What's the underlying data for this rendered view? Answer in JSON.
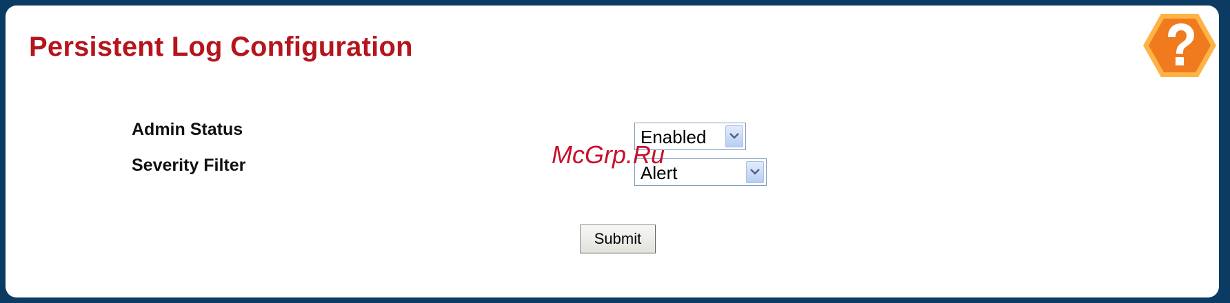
{
  "page": {
    "title": "Persistent Log Configuration"
  },
  "form": {
    "admin_status": {
      "label": "Admin Status",
      "value": "Enabled"
    },
    "severity_filter": {
      "label": "Severity Filter",
      "value": "Alert"
    },
    "submit_label": "Submit"
  },
  "watermark": "McGrp.Ru",
  "icons": {
    "help": "help-icon"
  },
  "colors": {
    "title": "#b5151d",
    "frame_border": "#0b3a63",
    "help_icon_fill": "#f07a1e",
    "help_icon_ring": "#ffb347",
    "watermark": "#c8102e"
  }
}
